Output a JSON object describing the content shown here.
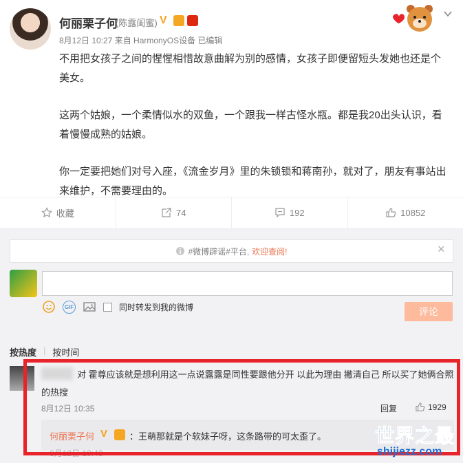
{
  "post": {
    "author": "何丽栗子何",
    "remark": "(陈露闺蜜)",
    "v_badge": "V",
    "meta": "8月12日 10:27 来自 HarmonyOS设备   已编辑",
    "paragraphs": [
      "不用把女孩子之间的惺惺相惜故意曲解为别的感情，女孩子即便留短头发她也还是个美女。",
      "这两个姑娘，一个柔情似水的双鱼，一个跟我一样古怪水瓶。都是我20出头认识，看着慢慢成熟的姑娘。",
      "你一定要把她们对号入座，《流金岁月》里的朱锁锁和蒋南孙，就对了，朋友有事站出来维护，不需要理由的。"
    ]
  },
  "actions": {
    "collect": "收藏",
    "repost_count": "74",
    "comment_count": "192",
    "like_count": "10852"
  },
  "notice": {
    "tag": "#微博辟谣#平台,",
    "link": "欢迎查阅!"
  },
  "composer": {
    "gif_label": "GIF",
    "repost_option": "同时转发到我的微博",
    "submit_label": "评论"
  },
  "sort": {
    "by_hot": "按热度",
    "divider": "|",
    "by_time": "按时间"
  },
  "comment": {
    "text": "对 霍尊应该就是想利用这一点说露露是同性要跟他分开 以此为理由 撇清自己 所以买了她俩合照的热搜",
    "time": "8月12日 10:35",
    "reply_label": "回复",
    "like_count": "1929"
  },
  "sub_reply": {
    "author": "何丽栗子何",
    "v_badge": "V",
    "text": "：王萌那就是个软妹子呀，这条路带的可太歪了。",
    "time": "8月12日 10:43"
  },
  "watermark": {
    "title": "世界之最",
    "url": "shijiezz.com"
  },
  "colors": {
    "link_orange": "#eb7350",
    "highlight_red": "#e8242b",
    "watermark_blue": "#1e6fd2"
  }
}
